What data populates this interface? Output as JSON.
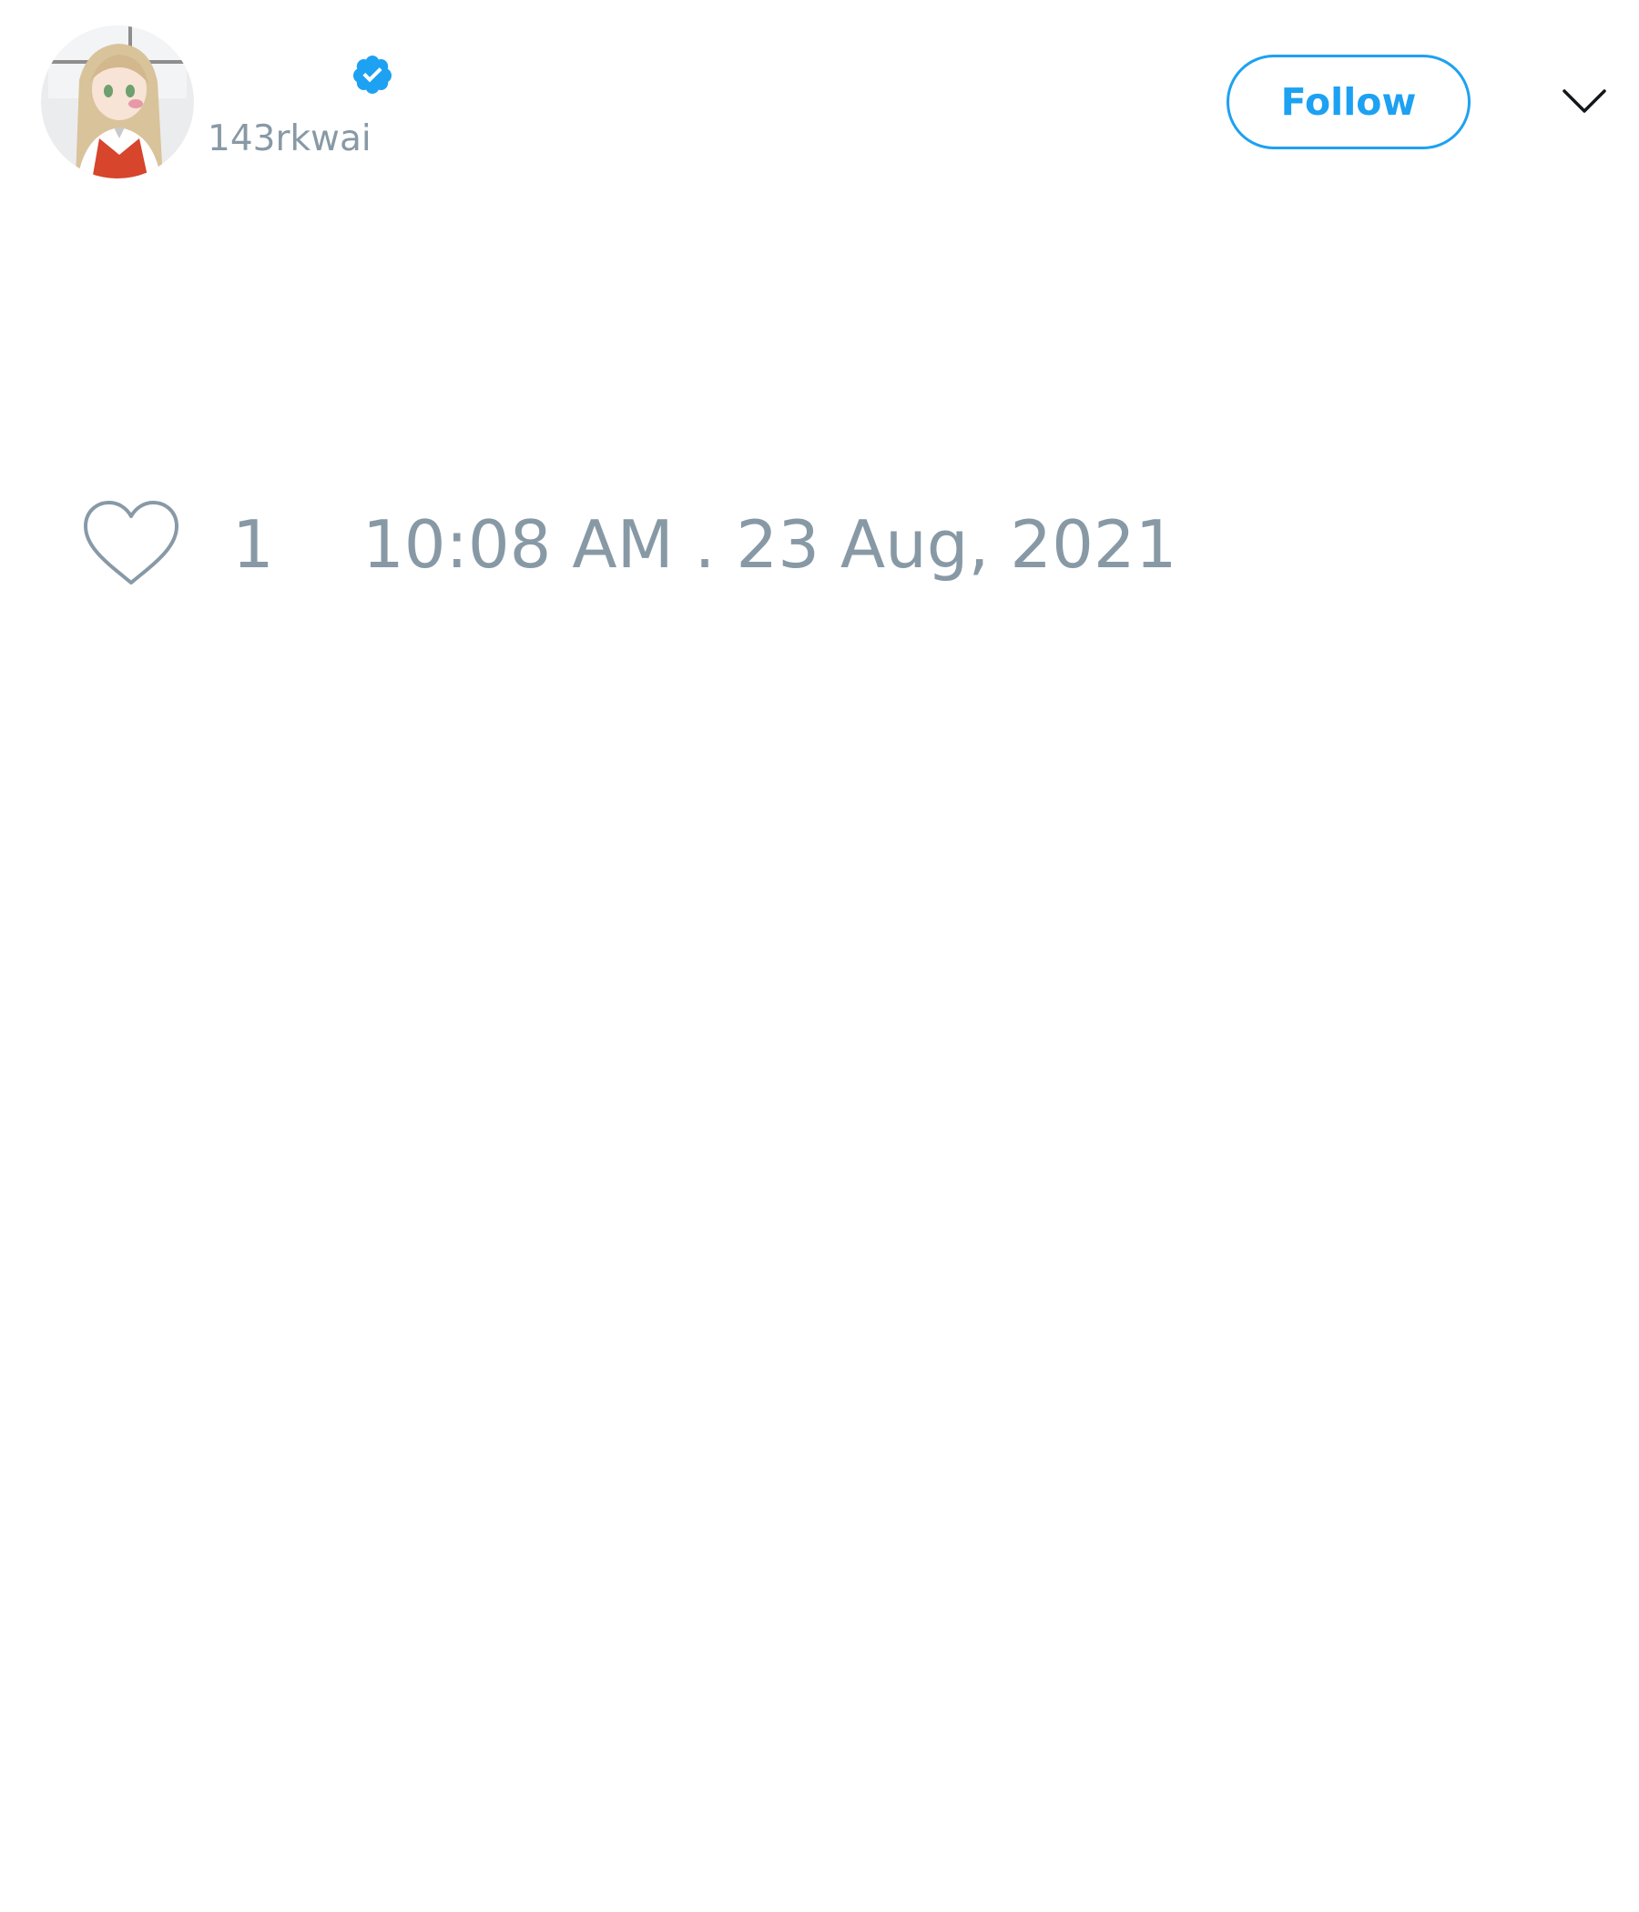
{
  "tweet": {
    "author": {
      "display_name": "",
      "handle": "143rkwai",
      "verified": true,
      "avatar_icon": "avatar-image"
    },
    "follow_label": "Follow",
    "menu_icon": "chevron-down-icon",
    "like_icon": "heart-icon",
    "like_count": "1",
    "timestamp": "10:08 AM . 23 Aug, 2021"
  },
  "colors": {
    "accent": "#1da1f2",
    "muted_text": "#8899a6",
    "background": "#ffffff"
  }
}
